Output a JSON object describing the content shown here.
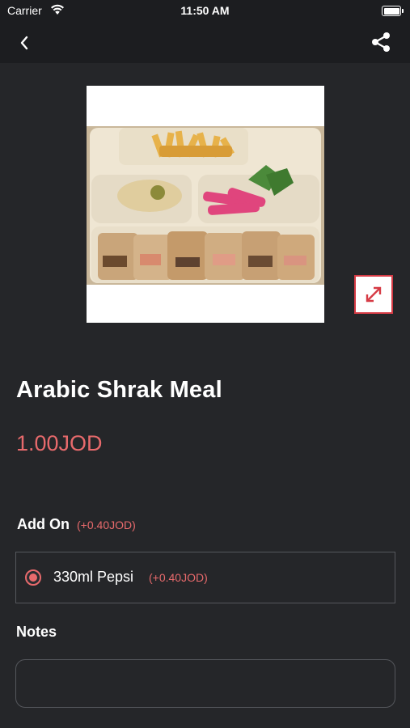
{
  "status_bar": {
    "carrier": "Carrier",
    "time": "11:50 AM"
  },
  "nav": {
    "back_icon": "chevron-left-icon",
    "share_icon": "share-icon"
  },
  "product": {
    "image_icon": "food-photo",
    "expand_icon": "expand-icon",
    "title": "Arabic Shrak Meal",
    "price": "1.00JOD"
  },
  "addon": {
    "header": "Add On",
    "header_extra": "(+0.40JOD)",
    "options": [
      {
        "label": "330ml Pepsi",
        "price": "(+0.40JOD)",
        "selected": true
      }
    ]
  },
  "notes": {
    "label": "Notes",
    "value": "",
    "placeholder": ""
  },
  "colors": {
    "background": "#252629",
    "accent": "#e86a6c",
    "expand_border": "#d63b45"
  }
}
